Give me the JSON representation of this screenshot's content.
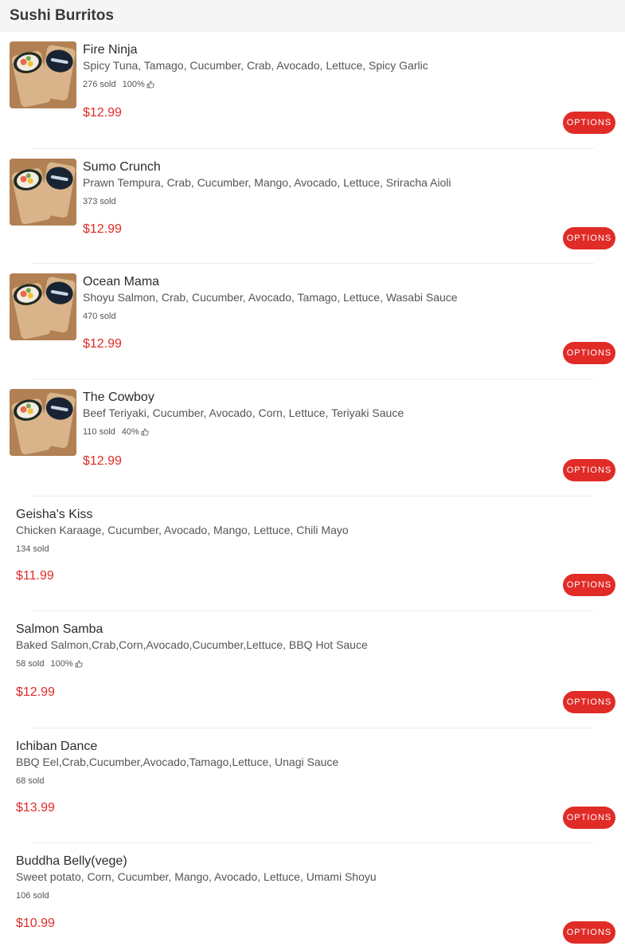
{
  "category": {
    "title": "Sushi Burritos"
  },
  "ui": {
    "options_label": "OPTIONS",
    "price_color": "#e02b27",
    "button_color": "#e02b27"
  },
  "items": [
    {
      "name": "Fire Ninja",
      "description": "Spicy Tuna, Tamago, Cucumber, Crab, Avocado, Lettuce, Spicy Garlic",
      "sold": "276 sold",
      "rating": "100%",
      "price": "$12.99",
      "has_image": true
    },
    {
      "name": "Sumo Crunch",
      "description": "Prawn Tempura, Crab, Cucumber, Mango, Avocado, Lettuce, Sriracha Aioli",
      "sold": "373 sold",
      "rating": "",
      "price": "$12.99",
      "has_image": true
    },
    {
      "name": "Ocean Mama",
      "description": "Shoyu Salmon, Crab, Cucumber, Avocado, Tamago, Lettuce, Wasabi Sauce",
      "sold": "470 sold",
      "rating": "",
      "price": "$12.99",
      "has_image": true
    },
    {
      "name": "The Cowboy",
      "description": "Beef Teriyaki, Cucumber, Avocado, Corn, Lettuce, Teriyaki Sauce",
      "sold": "110 sold",
      "rating": "40%",
      "price": "$12.99",
      "has_image": true
    },
    {
      "name": "Geisha's Kiss",
      "description": "Chicken Karaage, Cucumber, Avocado, Mango, Lettuce, Chili Mayo",
      "sold": "134 sold",
      "rating": "",
      "price": "$11.99",
      "has_image": false
    },
    {
      "name": "Salmon Samba",
      "description": "Baked Salmon,Crab,Corn,Avocado,Cucumber,Lettuce, BBQ Hot Sauce",
      "sold": "58 sold",
      "rating": "100%",
      "price": "$12.99",
      "has_image": false
    },
    {
      "name": "Ichiban Dance",
      "description": "BBQ Eel,Crab,Cucumber,Avocado,Tamago,Lettuce, Unagi Sauce",
      "sold": "68 sold",
      "rating": "",
      "price": "$13.99",
      "has_image": false
    },
    {
      "name": "Buddha Belly(vege)",
      "description": "Sweet potato, Corn, Cucumber, Mango, Avocado, Lettuce, Umami Shoyu",
      "sold": "106 sold",
      "rating": "",
      "price": "$10.99",
      "has_image": false
    }
  ]
}
